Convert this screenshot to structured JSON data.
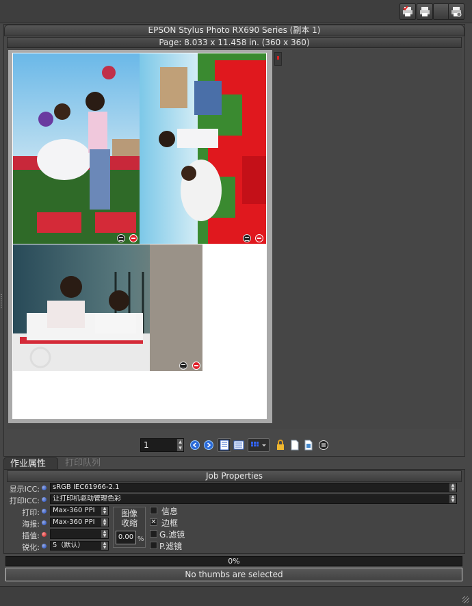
{
  "window": {
    "printer_title": "EPSON Stylus Photo RX690 Series (副本 1)",
    "page_info": "Page: 8.033 x 11.458 in.  (360 x 360)"
  },
  "toolbar": {
    "icons": [
      "printer-red-check-icon",
      "printer-icon",
      "blank-button",
      "printer-settings-icon"
    ]
  },
  "navigation": {
    "page_value": "1",
    "icons": [
      "prev-icon",
      "next-icon",
      "view-single-icon",
      "view-list-icon",
      "grid-icon",
      "lock-icon",
      "page-icon",
      "page-edit-icon",
      "menu-icon"
    ]
  },
  "tabs": [
    {
      "label": "作业属性",
      "active": true
    },
    {
      "label": "打印队列",
      "active": false
    }
  ],
  "job_properties": {
    "title": "Job Properties",
    "display_icc_label": "显示ICC:",
    "display_icc_value": "sRGB IEC61966-2.1",
    "print_icc_label": "打印ICC:",
    "print_icc_value": "让打印机驱动管理色彩",
    "print_label": "打印:",
    "print_value": "Max-360 PPI",
    "poster_label": "海报:",
    "poster_value": "Max-360 PPI",
    "interp_label": "插值:",
    "interp_value": "",
    "sharpen_label": "锐化:",
    "sharpen_value": "5（默认）",
    "scale_title": "图像收缩",
    "scale_value": "0.00",
    "scale_unit": "%",
    "options": [
      {
        "label": "信息",
        "checked": false
      },
      {
        "label": "边框",
        "checked": true
      },
      {
        "label": "G.滤镜",
        "checked": false
      },
      {
        "label": "P.滤镜",
        "checked": false
      }
    ],
    "checked_mark": "✕"
  },
  "progress": {
    "percent": 0,
    "text": "0%"
  },
  "status": {
    "text": "No thumbs are selected"
  },
  "colors": {
    "accent_blue": "#1848c8",
    "alert_red": "#c01818",
    "background": "#474747"
  }
}
